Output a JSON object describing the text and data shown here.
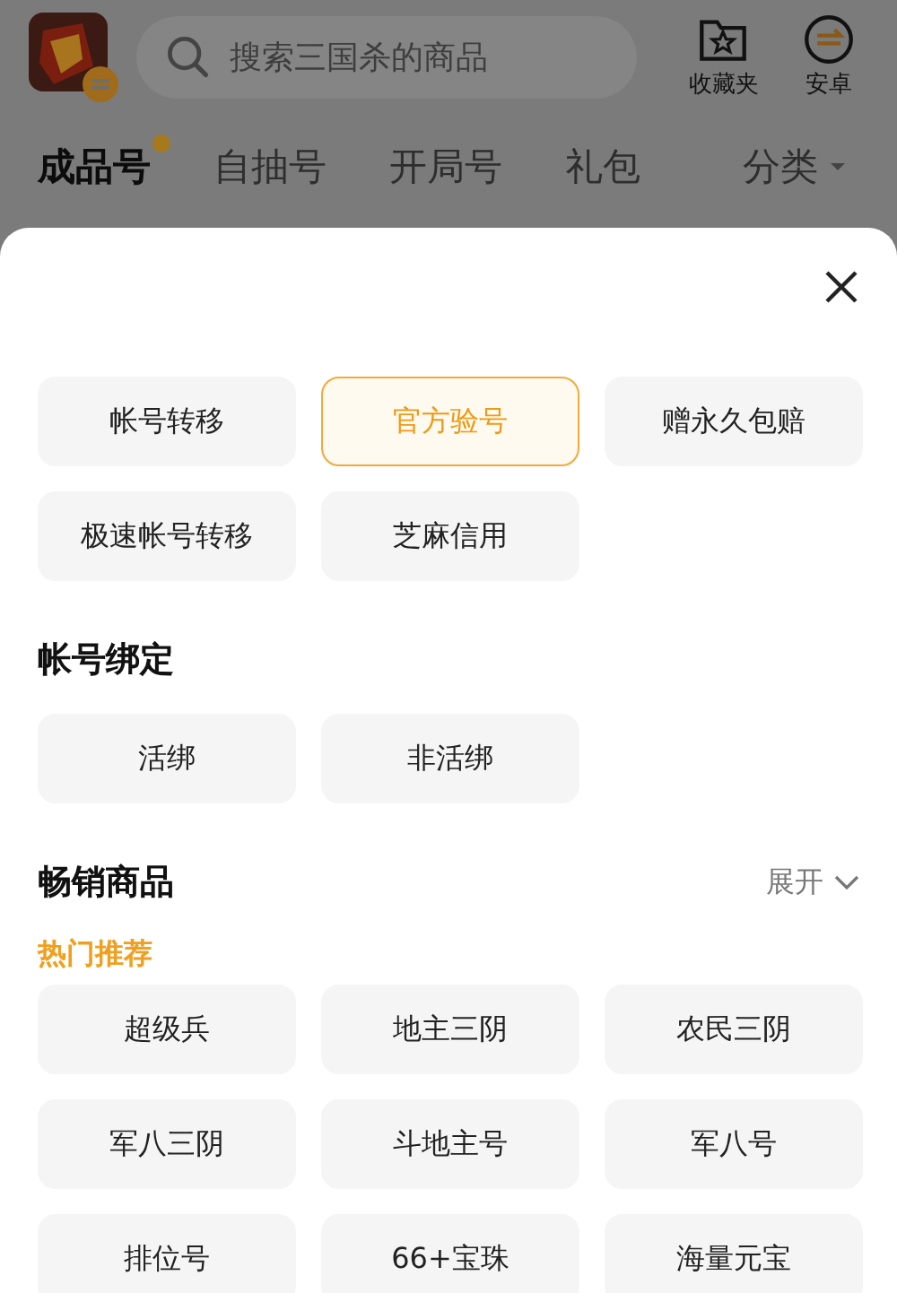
{
  "header": {
    "search": {
      "placeholder": "搜索三国杀的商品"
    },
    "actions": [
      {
        "kind": "favorites",
        "label": "收藏夹"
      },
      {
        "kind": "platform",
        "label": "安卓"
      }
    ]
  },
  "tabs": [
    {
      "label": "成品号",
      "selected": true,
      "kind": "tab",
      "dot": true
    },
    {
      "label": "自抽号",
      "selected": false,
      "kind": "tab",
      "dot": false
    },
    {
      "label": "开局号",
      "selected": false,
      "kind": "tab",
      "dot": false
    },
    {
      "label": "礼包",
      "selected": false,
      "kind": "tab",
      "dot": false
    },
    {
      "label": "分类",
      "selected": false,
      "kind": "dropdown",
      "dot": false
    }
  ],
  "filter_sheet": {
    "sections": [
      {
        "chips": [
          {
            "label": "帐号转移",
            "selected": false
          },
          {
            "label": "官方验号",
            "selected": true
          },
          {
            "label": "赠永久包赔",
            "selected": false
          },
          {
            "label": "极速帐号转移",
            "selected": false
          },
          {
            "label": "芝麻信用",
            "selected": false
          }
        ]
      },
      {
        "title": "帐号绑定",
        "chips": [
          {
            "label": "活绑",
            "selected": false
          },
          {
            "label": "非活绑",
            "selected": false
          }
        ]
      },
      {
        "title": "畅销商品",
        "toggle": "展开",
        "subtitle": "热门推荐",
        "chips": [
          {
            "label": "超级兵",
            "selected": false
          },
          {
            "label": "地主三阴",
            "selected": false
          },
          {
            "label": "农民三阴",
            "selected": false
          },
          {
            "label": "军八三阴",
            "selected": false
          },
          {
            "label": "斗地主号",
            "selected": false
          },
          {
            "label": "军八号",
            "selected": false
          },
          {
            "label": "排位号",
            "selected": false
          },
          {
            "label": "66+宝珠",
            "selected": false
          },
          {
            "label": "海量元宝",
            "selected": false
          }
        ]
      }
    ]
  }
}
